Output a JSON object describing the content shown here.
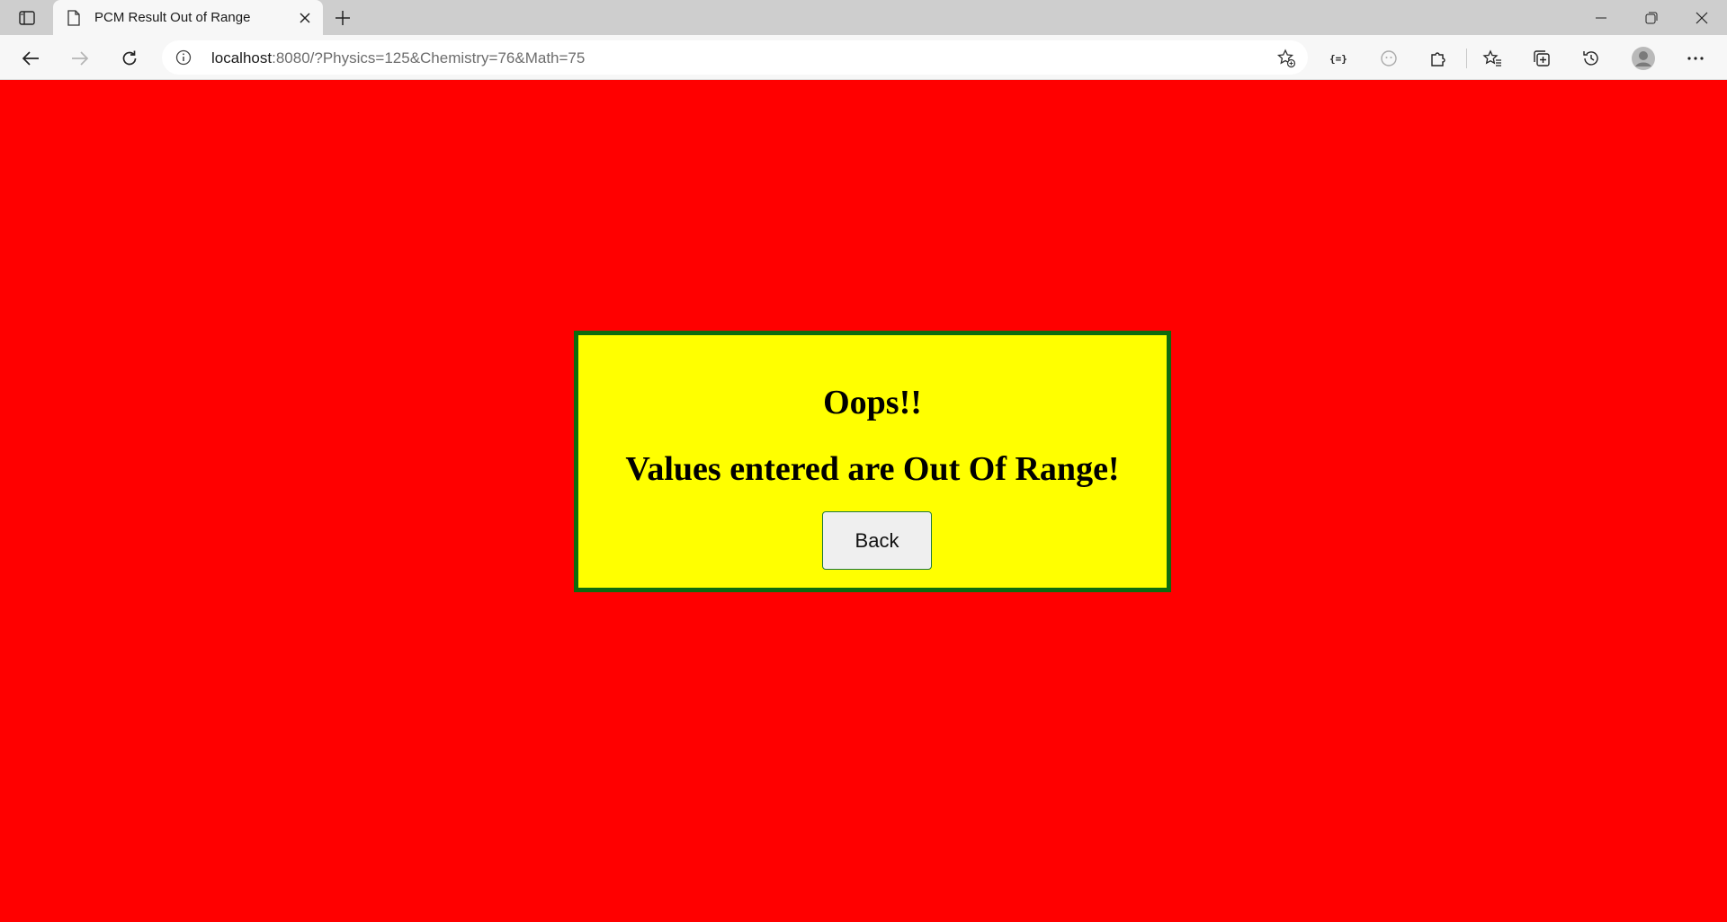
{
  "browser": {
    "tab": {
      "title": "PCM Result Out of Range"
    },
    "address": {
      "host": "localhost",
      "rest": ":8080/?Physics=125&Chemistry=76&Math=75"
    }
  },
  "page": {
    "background_color": "#ff0000",
    "card_color": "#ffff00",
    "card_border_color": "#0e6b0e",
    "heading": "Oops!!",
    "message": "Values entered are Out Of Range!",
    "back_button": "Back"
  }
}
